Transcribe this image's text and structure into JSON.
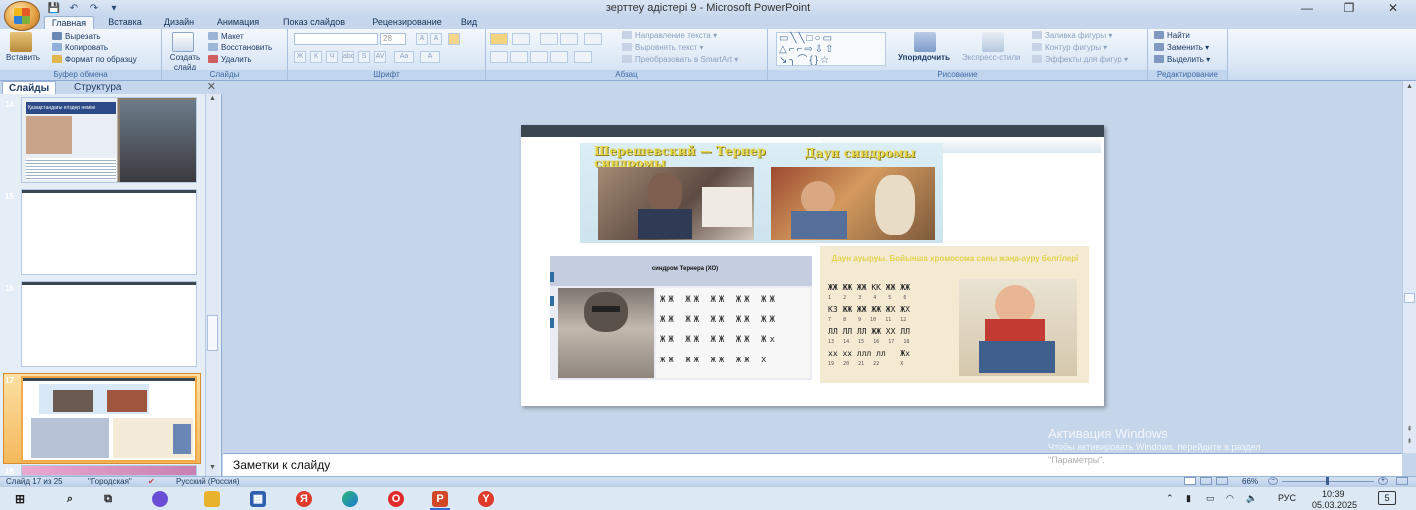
{
  "window": {
    "title": "зерттеу адістері 9 - Microsoft PowerPoint",
    "minimize": "—",
    "maximize": "❐",
    "close": "✕"
  },
  "qat": {
    "save": "💾",
    "undo": "↶",
    "redo": "↷",
    "more": "▾"
  },
  "tabs": [
    "Главная",
    "Вставка",
    "Дизайн",
    "Анимация",
    "Показ слайдов",
    "Рецензирование",
    "Вид"
  ],
  "ribbon": {
    "clipboard": {
      "paste": "Вставить",
      "cut": "Вырезать",
      "copy": "Копировать",
      "format_painter": "Формат по образцу",
      "label": "Буфер обмена"
    },
    "slides": {
      "new_slide": "Создать слайд",
      "layout": "Макет",
      "reset": "Восстановить",
      "delete": "Удалить",
      "label": "Слайды"
    },
    "font": {
      "font_size": "28",
      "label": "Шрифт"
    },
    "paragraph": {
      "text_direction": "Направление текста",
      "align_text": "Выровнять текст",
      "smartart": "Преобразовать в SmartArt",
      "label": "Абзац"
    },
    "drawing": {
      "arrange": "Упорядочить",
      "quick_styles": "Экспресс-стили",
      "shape_fill": "Заливка фигуры",
      "shape_outline": "Контур фигуры",
      "shape_effects": "Эффекты для фигур",
      "label": "Рисование"
    },
    "editing": {
      "find": "Найти",
      "replace": "Заменить",
      "select": "Выделить",
      "label": "Редактирование"
    }
  },
  "panel": {
    "tab_slides": "Слайды",
    "tab_outline": "Структура",
    "close": "✕",
    "slide_numbers": [
      "14",
      "15",
      "16",
      "17",
      "18"
    ],
    "slide14_title": "Қазақстандағы егіздер неміні"
  },
  "slide": {
    "top_caption_left": "Шерешевский — Тернер синдромы",
    "top_caption_right": "Даун синдромы",
    "turner_caption": "синдром Тернера (ХО)",
    "down_caption": "Даун ауыруы. Бойынша хромосома саны жаңа-ауру белгілері",
    "karyotype_rows": [
      [
        "1",
        "2",
        "3",
        "4",
        "5",
        "6"
      ],
      [
        "7",
        "8",
        "9",
        "10",
        "11",
        "12"
      ],
      [
        "13",
        "14",
        "15",
        "16",
        "17",
        "18"
      ],
      [
        "19",
        "20",
        "21",
        "22",
        "X"
      ]
    ]
  },
  "notes": {
    "placeholder": "Заметки к слайду"
  },
  "watermark": {
    "line1": "Активация Windows",
    "line2": "Чтобы активировать Windows, перейдите в раздел",
    "line3": "\"Параметры\"."
  },
  "status": {
    "slide_info": "Слайд 17 из 25",
    "theme": "\"Городская\"",
    "language": "Русский (Россия)",
    "zoom": "66%"
  },
  "taskbar": {
    "lang": "РУС",
    "time": "10:39",
    "date": "05.03.2025",
    "notif_count": "5"
  }
}
